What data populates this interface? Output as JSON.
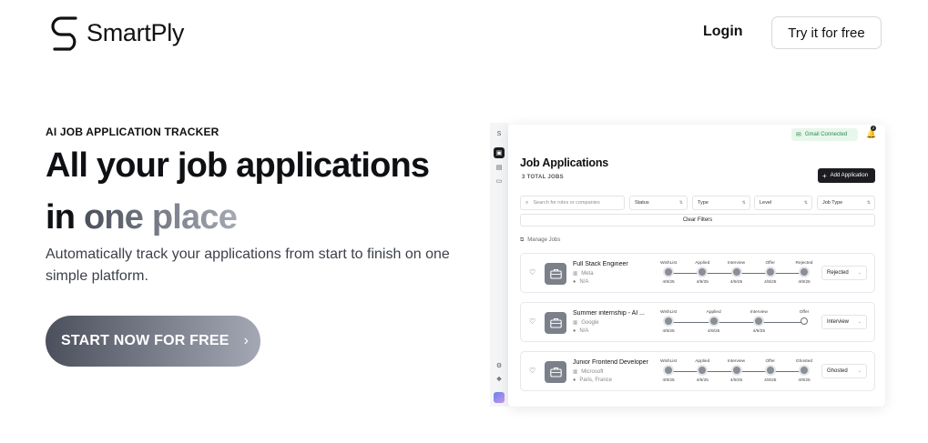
{
  "brand": {
    "name": "SmartPly"
  },
  "nav": {
    "login": "Login",
    "try_free": "Try it for free"
  },
  "hero": {
    "eyebrow": "AI JOB APPLICATION TRACKER",
    "title_line1": "All your job applications",
    "title_line2_prefix": "in ",
    "title_line2_highlight": "one place",
    "subtitle": "Automatically track your applications from start to finish on one simple platform.",
    "cta": "START NOW FOR FREE"
  },
  "app": {
    "gmail_status": "Gmail Connected",
    "notification_count": "2",
    "title": "Job Applications",
    "total": "3 TOTAL JOBS",
    "add_button": "Add Application",
    "search_placeholder": "Search for roles or companies",
    "filters": {
      "status": "Status",
      "type": "Type",
      "level": "Level",
      "job_type": "Job Type"
    },
    "clear_filters": "Clear Filters",
    "manage_jobs": "Manage Jobs",
    "jobs": [
      {
        "role": "Full Stack Engineer",
        "company": "Meta",
        "location": "N/A",
        "status": "Rejected",
        "stages": [
          {
            "label": "WishList",
            "date": "4/9/25",
            "done": true
          },
          {
            "label": "Applied",
            "date": "4/9/25",
            "done": true
          },
          {
            "label": "Interview",
            "date": "4/9/25",
            "done": true
          },
          {
            "label": "Offer",
            "date": "4/9/25",
            "done": true
          },
          {
            "label": "Rejected",
            "date": "4/9/25",
            "done": true
          }
        ]
      },
      {
        "role": "Summer internship - AI ...",
        "company": "Google",
        "location": "N/A",
        "status": "Interview",
        "stages": [
          {
            "label": "WishList",
            "date": "4/9/25",
            "done": true
          },
          {
            "label": "Applied",
            "date": "4/9/25",
            "done": true
          },
          {
            "label": "Interview",
            "date": "4/9/25",
            "done": true
          },
          {
            "label": "Offer",
            "date": "",
            "done": false
          }
        ]
      },
      {
        "role": "Junior Frontend Developer",
        "company": "Microsoft",
        "location": "Paris, France",
        "status": "Ghosted",
        "stages": [
          {
            "label": "WishList",
            "date": "4/9/25",
            "done": true
          },
          {
            "label": "Applied",
            "date": "4/9/25",
            "done": true
          },
          {
            "label": "Interview",
            "date": "4/9/25",
            "done": true
          },
          {
            "label": "Offer",
            "date": "4/9/25",
            "done": true
          },
          {
            "label": "Ghosted",
            "date": "4/9/25",
            "done": true
          }
        ]
      }
    ]
  },
  "icons": {
    "logo": "smartply-s-logo",
    "chevron": "chevron-right-icon",
    "heart": "heart-icon",
    "briefcase": "briefcase-icon",
    "building": "building-icon",
    "location": "location-pin-icon",
    "mail": "mail-icon",
    "bell": "bell-icon",
    "search": "search-icon"
  },
  "colors": {
    "dark": "#1c1d21",
    "gmail_green": "#2d8a4c",
    "cta_from": "#4c505c",
    "cta_to": "#a3a8b4"
  }
}
